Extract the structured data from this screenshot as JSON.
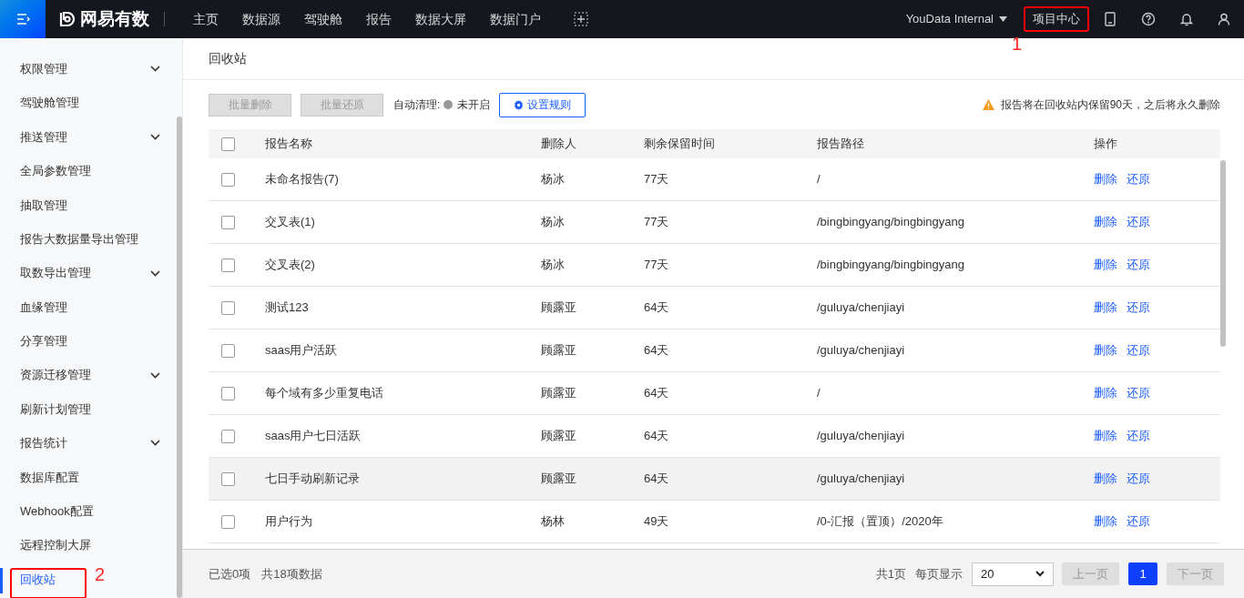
{
  "header": {
    "logo": "网易有数",
    "nav": [
      {
        "label": "主页",
        "selected": false
      },
      {
        "label": "数据源",
        "selected": false
      },
      {
        "label": "驾驶舱",
        "selected": false
      },
      {
        "label": "报告",
        "selected": false
      },
      {
        "label": "数据大屏",
        "selected": false
      },
      {
        "label": "数据门户",
        "selected": false
      }
    ],
    "workspace": "YouData Internal",
    "project_center": "项目中心",
    "project_center_annotation": "1"
  },
  "sidebar": {
    "items": [
      {
        "label": "权限管理",
        "expandable": true,
        "selected": false
      },
      {
        "label": "驾驶舱管理",
        "expandable": false,
        "selected": false
      },
      {
        "label": "推送管理",
        "expandable": true,
        "selected": false
      },
      {
        "label": "全局参数管理",
        "expandable": false,
        "selected": false
      },
      {
        "label": "抽取管理",
        "expandable": false,
        "selected": false
      },
      {
        "label": "报告大数据量导出管理",
        "expandable": false,
        "selected": false
      },
      {
        "label": "取数导出管理",
        "expandable": true,
        "selected": false
      },
      {
        "label": "血缘管理",
        "expandable": false,
        "selected": false
      },
      {
        "label": "分享管理",
        "expandable": false,
        "selected": false
      },
      {
        "label": "资源迁移管理",
        "expandable": true,
        "selected": false
      },
      {
        "label": "刷新计划管理",
        "expandable": false,
        "selected": false
      },
      {
        "label": "报告统计",
        "expandable": true,
        "selected": false
      },
      {
        "label": "数据库配置",
        "expandable": false,
        "selected": false
      },
      {
        "label": "Webhook配置",
        "expandable": false,
        "selected": false
      },
      {
        "label": "远程控制大屏",
        "expandable": false,
        "selected": false
      },
      {
        "label": "回收站",
        "expandable": false,
        "selected": true,
        "annotation": "2"
      }
    ]
  },
  "breadcrumb": "回收站",
  "toolbar": {
    "batch_delete": {
      "label": "批量删除",
      "disabled": true
    },
    "batch_restore": {
      "label": "批量还原",
      "disabled": true
    },
    "auto_clean_label": "自动清理:",
    "auto_clean_on": false,
    "auto_clean_status": "未开启",
    "settings_button": "设置规则",
    "notice": "报告将在回收站内保留90天，之后将永久删除"
  },
  "table": {
    "columns": [
      "报告名称",
      "删除人",
      "剩余保留时间",
      "报告路径",
      "操作"
    ],
    "header_checked": false,
    "rows": [
      {
        "name": "未命名报告(7)",
        "deleter": "杨冰",
        "remaining": "77天",
        "path": "/",
        "checked": false,
        "highlighted": false,
        "actions": [
          "删除",
          "还原"
        ]
      },
      {
        "name": "交叉表(1)",
        "deleter": "杨冰",
        "remaining": "77天",
        "path": "/bingbingyang/bingbingyang",
        "checked": false,
        "highlighted": false,
        "actions": [
          "删除",
          "还原"
        ]
      },
      {
        "name": "交叉表(2)",
        "deleter": "杨冰",
        "remaining": "77天",
        "path": "/bingbingyang/bingbingyang",
        "checked": false,
        "highlighted": false,
        "actions": [
          "删除",
          "还原"
        ]
      },
      {
        "name": "测试123",
        "deleter": "顾露亚",
        "remaining": "64天",
        "path": "/guluya/chenjiayi",
        "checked": false,
        "highlighted": false,
        "actions": [
          "删除",
          "还原"
        ]
      },
      {
        "name": "saas用户活跃",
        "deleter": "顾露亚",
        "remaining": "64天",
        "path": "/guluya/chenjiayi",
        "checked": false,
        "highlighted": false,
        "actions": [
          "删除",
          "还原"
        ]
      },
      {
        "name": "每个域有多少重复电话",
        "deleter": "顾露亚",
        "remaining": "64天",
        "path": "/",
        "checked": false,
        "highlighted": false,
        "actions": [
          "删除",
          "还原"
        ]
      },
      {
        "name": "saas用户七日活跃",
        "deleter": "顾露亚",
        "remaining": "64天",
        "path": "/guluya/chenjiayi",
        "checked": false,
        "highlighted": false,
        "actions": [
          "删除",
          "还原"
        ]
      },
      {
        "name": "七日手动刷新记录",
        "deleter": "顾露亚",
        "remaining": "64天",
        "path": "/guluya/chenjiayi",
        "checked": false,
        "highlighted": true,
        "actions": [
          "删除",
          "还原"
        ]
      },
      {
        "name": "用户行为",
        "deleter": "杨林",
        "remaining": "49天",
        "path": "/0-汇报（置顶）/2020年",
        "checked": false,
        "highlighted": false,
        "actions": [
          "删除",
          "还原"
        ]
      }
    ]
  },
  "footer": {
    "selected_count": "已选0项",
    "total": "共18项数据",
    "pages": "共1页",
    "per_page_label": "每页显示",
    "per_page": "20",
    "prev": {
      "label": "上一页",
      "disabled": true
    },
    "page_buttons": [
      {
        "label": "1",
        "selected": true
      }
    ],
    "next": {
      "label": "下一页",
      "disabled": true
    }
  }
}
